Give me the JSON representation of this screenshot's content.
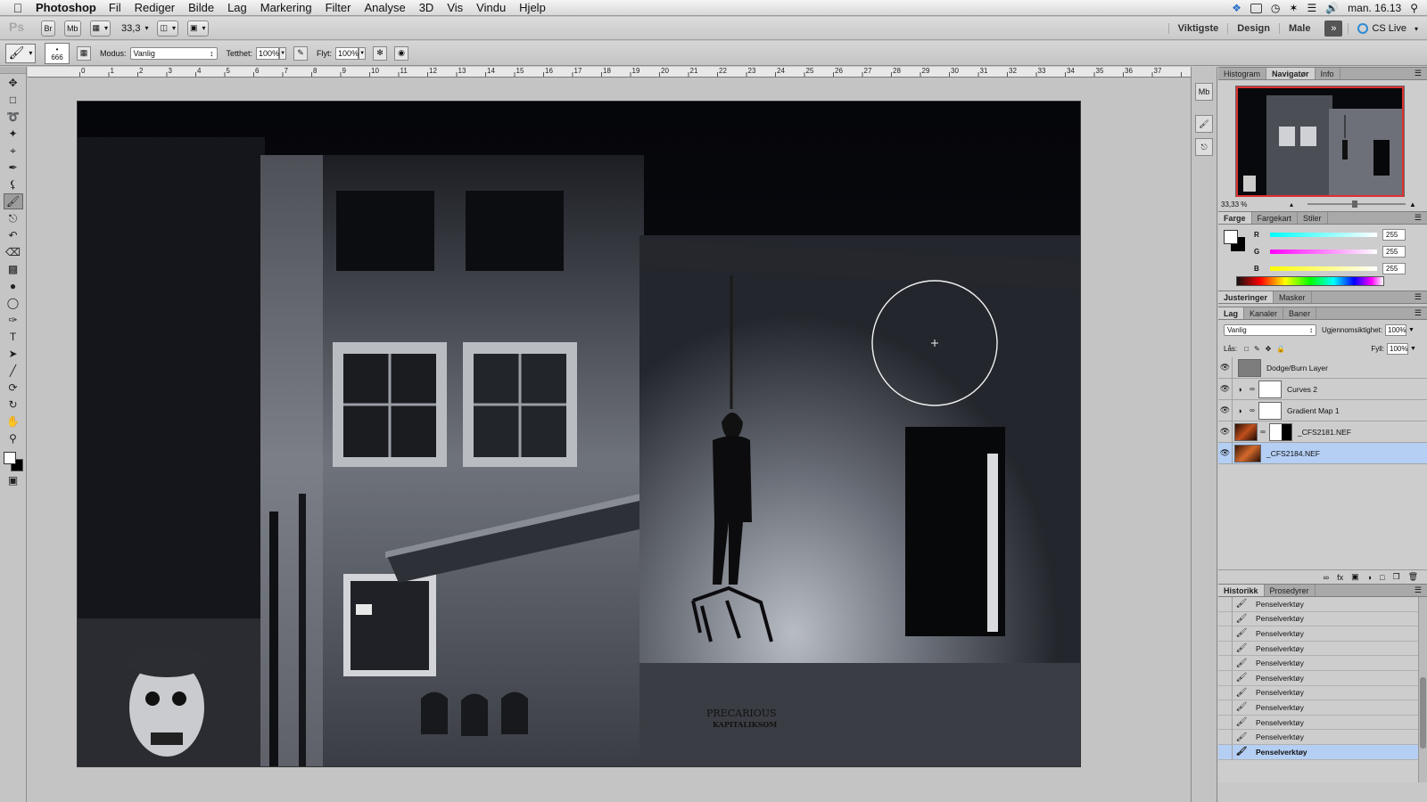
{
  "menubar": {
    "app_name": "Photoshop",
    "items": [
      "Fil",
      "Rediger",
      "Bilde",
      "Lag",
      "Markering",
      "Filter",
      "Analyse",
      "3D",
      "Vis",
      "Vindu",
      "Hjelp"
    ],
    "clock": "man. 16.13"
  },
  "appbar": {
    "logo": "Ps",
    "bridge": "Br",
    "minibridge": "Mb",
    "zoom": "33,3",
    "workspaces": [
      "Viktigste",
      "Design",
      "Male"
    ],
    "more": "»",
    "cslive": "CS Live"
  },
  "options": {
    "brush_size": "666",
    "mode_label": "Modus:",
    "mode_value": "Vanlig",
    "opacity_label": "Tetthet:",
    "opacity_value": "100%",
    "flow_label": "Flyt:",
    "flow_value": "100%"
  },
  "ruler": {
    "marks": [
      "0",
      "1",
      "2",
      "3",
      "4",
      "5",
      "6",
      "7",
      "8",
      "9",
      "10",
      "11",
      "12",
      "13",
      "14",
      "15",
      "16",
      "17",
      "18",
      "19",
      "20",
      "21",
      "22",
      "23",
      "24",
      "25",
      "26",
      "27",
      "28",
      "29",
      "30",
      "31",
      "32",
      "33",
      "34",
      "35",
      "36",
      "37"
    ]
  },
  "image": {
    "graffiti_text_1": "PRECARIOUS",
    "graffiti_text_2": "KAPITALIKSOM"
  },
  "navigator": {
    "tabs": [
      "Histogram",
      "Navigatør",
      "Info"
    ],
    "active_tab": "Navigatør",
    "zoom": "33,33 %"
  },
  "color": {
    "tabs": [
      "Farge",
      "Fargekart",
      "Stiler"
    ],
    "r_label": "R",
    "g_label": "G",
    "b_label": "B",
    "r": "255",
    "g": "255",
    "b": "255"
  },
  "adjustments": {
    "tabs": [
      "Justeringer",
      "Masker"
    ]
  },
  "layers": {
    "tabs": [
      "Lag",
      "Kanaler",
      "Baner"
    ],
    "blend_mode": "Vanlig",
    "opacity_label": "Ugjennomsiktighet:",
    "opacity": "100%",
    "lock_label": "Lås:",
    "fill_label": "Fyll:",
    "fill": "100%",
    "items": [
      {
        "name": "Dodge/Burn Layer",
        "type": "pixel",
        "selected": false
      },
      {
        "name": "Curves 2",
        "type": "adjustment",
        "selected": false
      },
      {
        "name": "Gradient Map 1",
        "type": "adjustment",
        "selected": false
      },
      {
        "name": "_CFS2181.NEF",
        "type": "masked",
        "selected": false
      },
      {
        "name": "_CFS2184.NEF",
        "type": "photo",
        "selected": true
      }
    ]
  },
  "history": {
    "tabs": [
      "Historikk",
      "Prosedyrer"
    ],
    "items": [
      "Penselverktøy",
      "Penselverktøy",
      "Penselverktøy",
      "Penselverktøy",
      "Penselverktøy",
      "Penselverktøy",
      "Penselverktøy",
      "Penselverktøy",
      "Penselverktøy",
      "Penselverktøy",
      "Penselverktøy"
    ]
  },
  "colors": {
    "selection": "#b5cff4",
    "nav_frame": "#e03030"
  }
}
